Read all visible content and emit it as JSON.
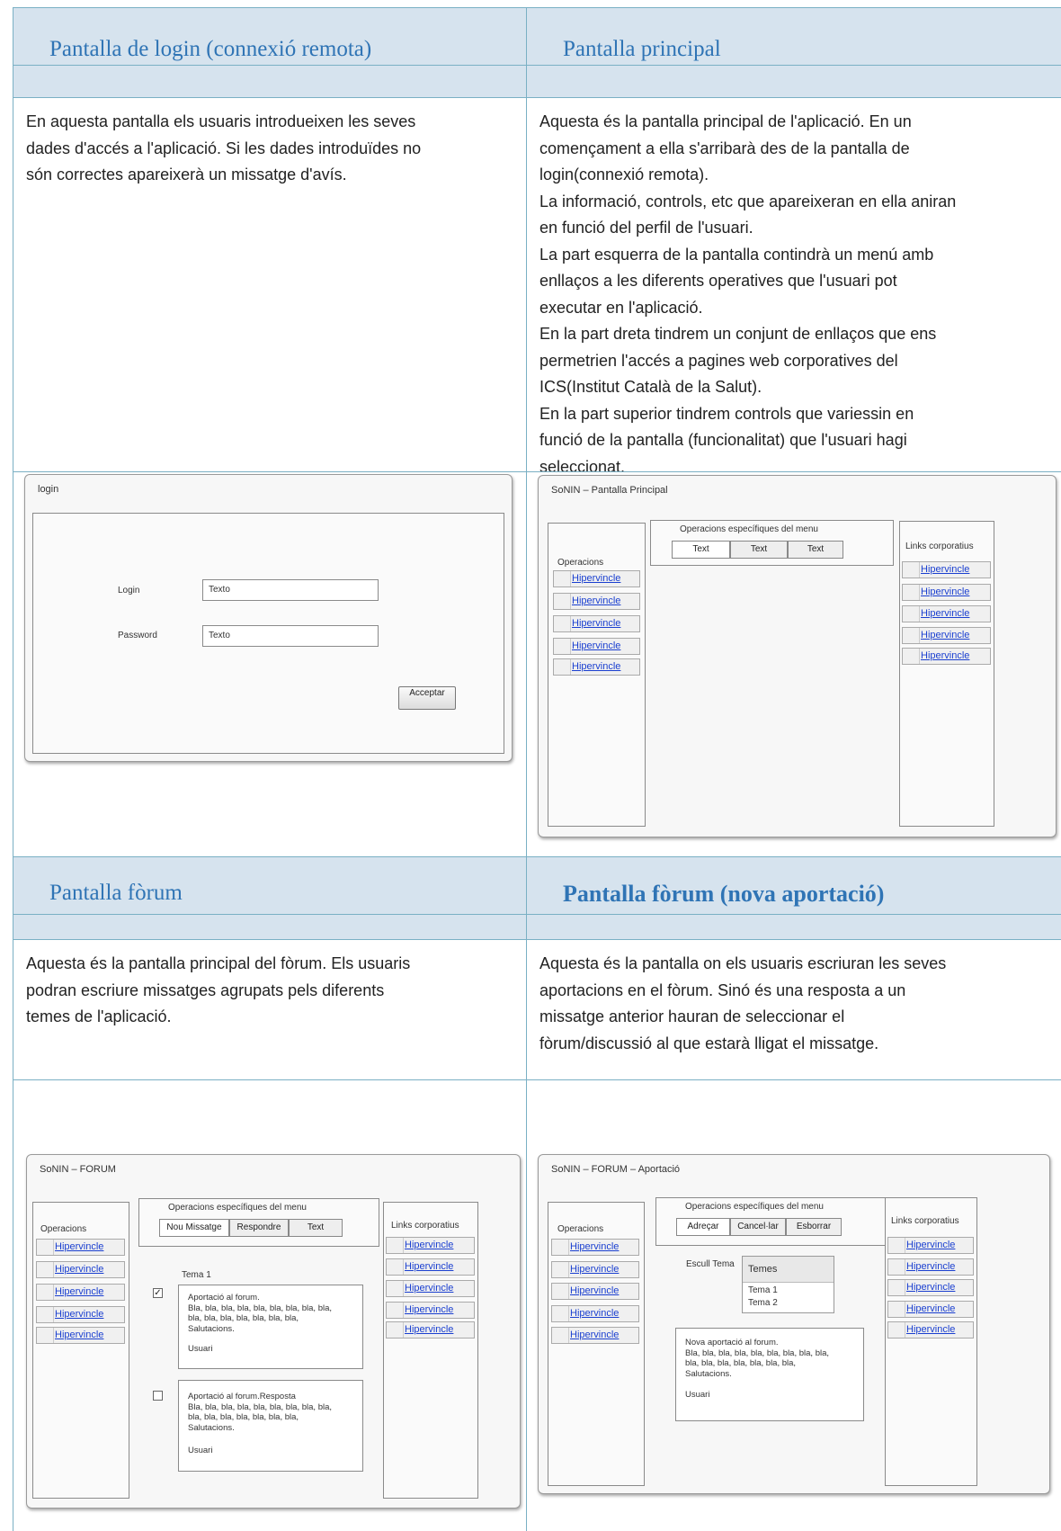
{
  "headers": {
    "login": "Pantalla de login (connexió remota)",
    "principal": "Pantalla principal",
    "forum": "Pantalla  fòrum",
    "forum_nova": "Pantalla fòrum (nova aportació)"
  },
  "descriptions": {
    "login": [
      "En aquesta pantalla els usuaris introdueixen les seves",
      "dades d'accés a l'aplicació. Si les dades introduïdes no",
      "són correctes apareixerà un missatge d'avís."
    ],
    "principal": [
      "Aquesta és la pantalla principal de l'aplicació. En un",
      "començament a ella s'arribarà des de la pantalla de",
      "login(connexió remota).",
      "La informació, controls, etc que apareixeran en ella aniran",
      "en funció del perfil de l'usuari.",
      "La part esquerra de la pantalla contindrà un menú amb",
      "enllaços a les diferents operatives que l'usuari pot",
      "executar en l'aplicació.",
      "En la part dreta tindrem un conjunt de enllaços que ens",
      "permetrien l'accés a pagines web corporatives del",
      "ICS(Institut Català de la Salut).",
      "En la part superior tindrem controls que variessin en",
      "funció de la pantalla (funcionalitat) que l'usuari hagi",
      "seleccionat."
    ],
    "forum": [
      "Aquesta és la pantalla principal del fòrum. Els usuaris",
      "podran escriure missatges agrupats pels diferents",
      "temes de l'aplicació."
    ],
    "forum_nova": [
      "Aquesta és la pantalla on els usuaris escriuran les seves",
      "aportacions en el fòrum. Sinó és una resposta a un",
      "missatge anterior hauran de seleccionar el",
      "fòrum/discussió al que estarà lligat el missatge."
    ]
  },
  "login_mock": {
    "title": "login",
    "login_label": "Login",
    "login_value": "Texto",
    "password_label": "Password",
    "password_value": "Texto",
    "accept": "Acceptar"
  },
  "principal_mock": {
    "title": "SoNIN – Pantalla Principal",
    "ops_title": "Operacions",
    "menu_title": "Operacions específiques del menu",
    "tabs": [
      "Text",
      "Text",
      "Text"
    ],
    "links_title": "Links corporatius",
    "link": "Hipervincle"
  },
  "forum_mock": {
    "title": "SoNIN – FORUM",
    "ops_title": "Operacions",
    "menu_title": "Operacions específiques del menu",
    "tabs": [
      "Nou Missatge",
      "Respondre",
      "Text"
    ],
    "links_title": "Links corporatius",
    "link": "Hipervincle",
    "tema": "Tema 1",
    "check_mark": "✓",
    "post1": [
      "Aportació al forum.",
      "Bla, bla, bla, bla, bla, bla, bla, bla, bla,",
      "bla, bla, bla, bla, bla, bla, bla,",
      "Salutacions.",
      "",
      "Usuari"
    ],
    "post2": [
      "Aportació al forum.Resposta",
      "Bla, bla, bla, bla, bla, bla, bla, bla, bla,",
      "bla, bla, bla, bla, bla, bla, bla,",
      "Salutacions.",
      "",
      "Usuari"
    ]
  },
  "aport_mock": {
    "title": "SoNIN – FORUM – Aportació",
    "ops_title": "Operacions",
    "menu_title": "Operacions específiques del menu",
    "tabs": [
      "Adreçar",
      "Cancel·lar",
      "Esborrar"
    ],
    "links_title": "Links corporatius",
    "link": "Hipervincle",
    "escull": "Escull Tema",
    "temes_header": "Temes",
    "temes": [
      "Tema 1",
      "Tema 2"
    ],
    "post": [
      "Nova aportació al forum.",
      "Bla, bla, bla, bla, bla, bla, bla, bla, bla,",
      "bla, bla, bla, bla, bla, bla, bla,",
      "Salutacions.",
      "",
      "Usuari"
    ]
  }
}
